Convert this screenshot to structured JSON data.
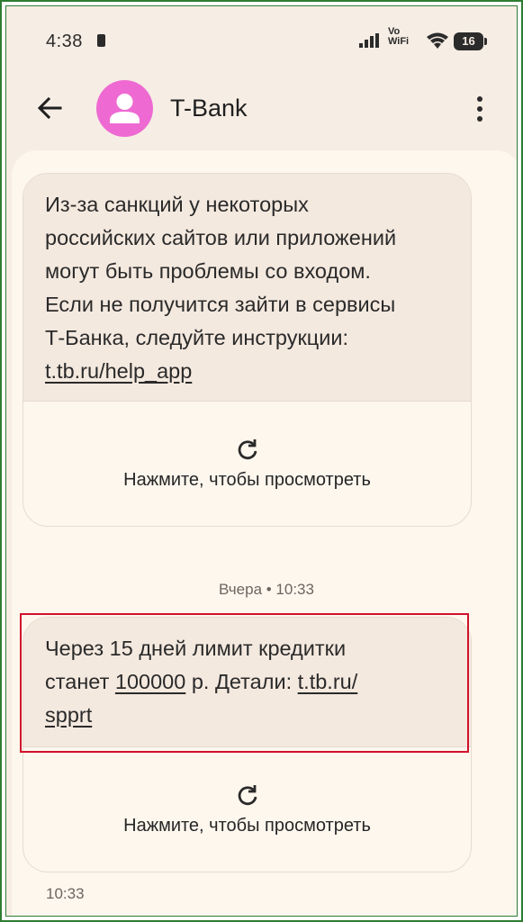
{
  "status_bar": {
    "time": "4:38",
    "network_label": "Vo\nWiFi",
    "battery_level": "16"
  },
  "app_bar": {
    "title": "T-Bank",
    "avatar_color": "#ee6ad2"
  },
  "messages": [
    {
      "text_lines": [
        "Из-за санкций у некоторых",
        "российских сайтов или приложений",
        "могут быть проблемы со входом.",
        "Если не получится зайти в сервисы",
        "Т-Банка, следуйте инструкции:"
      ],
      "link": "t.tb.ru/help_app",
      "preview_label": "Нажмите, чтобы просмотреть"
    },
    {
      "line1": "Через 15 дней лимит кредитки",
      "line2_pre": "станет ",
      "amount": "100000",
      "line2_mid": " р. Детали: ",
      "link_part1": "t.tb.ru/",
      "link_part2": "spprt",
      "preview_label": "Нажмите, чтобы просмотреть",
      "time": "10:33"
    }
  ],
  "date_separator": "Вчера • 10:33",
  "colors": {
    "highlight_border": "#d0112b",
    "frame_border": "#2e7d32",
    "background": "#f6ede4"
  }
}
